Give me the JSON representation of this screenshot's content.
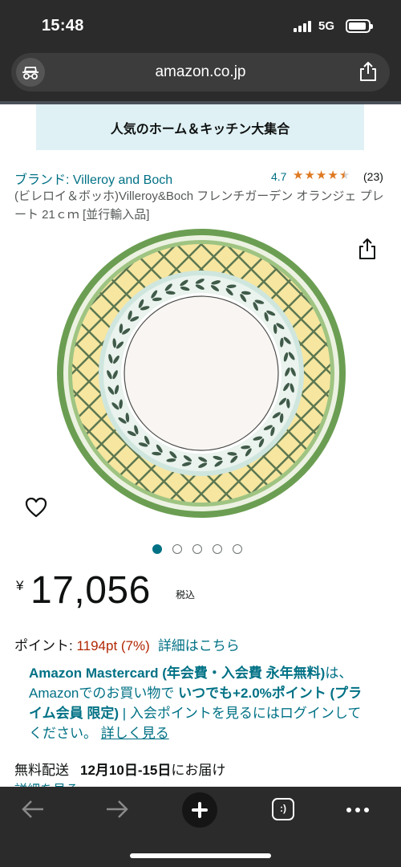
{
  "status_bar": {
    "time": "15:48",
    "network": "5G",
    "battery_level": 0.9
  },
  "browser": {
    "url": "amazon.co.jp",
    "tab_count_label": ":)"
  },
  "banner": {
    "text": "人気のホーム＆キッチン大集合"
  },
  "product": {
    "brand_link": "ブランド: Villeroy and Boch",
    "rating": "4.7",
    "stars_filled": 4.5,
    "rating_count": "(23)",
    "title": "(ビレロイ＆ボッホ)Villeroy&Boch フレンチガーデン オランジェ プレート 21ｃｍ [並行輸入品]",
    "image_count": 5,
    "active_image": 0
  },
  "price": {
    "currency": "¥",
    "amount": "17,056",
    "tax_label": "税込"
  },
  "points": {
    "label": "ポイント: ",
    "value": "1194pt (7%)",
    "link": "詳細はこちら"
  },
  "card_promo": {
    "bold1": "Amazon Mastercard (年会費・入会費 永年無料)",
    "text1": "は、Amazonでのお買い物で ",
    "bold2": "いつでも+2.0%ポイント (プライム会員 限定)",
    "text2": " | 入会ポイントを見るにはログインしてください。 ",
    "link": "詳しく見る"
  },
  "shipping": {
    "label": "無料配送",
    "date": "12月10日-15日",
    "suffix": "にお届け",
    "details_link": "詳細を見る"
  },
  "colors": {
    "link": "#007185",
    "price_red": "#b12704",
    "star": "#de7921",
    "banner_bg": "#dff1f4",
    "chrome": "#2b2b2b"
  }
}
